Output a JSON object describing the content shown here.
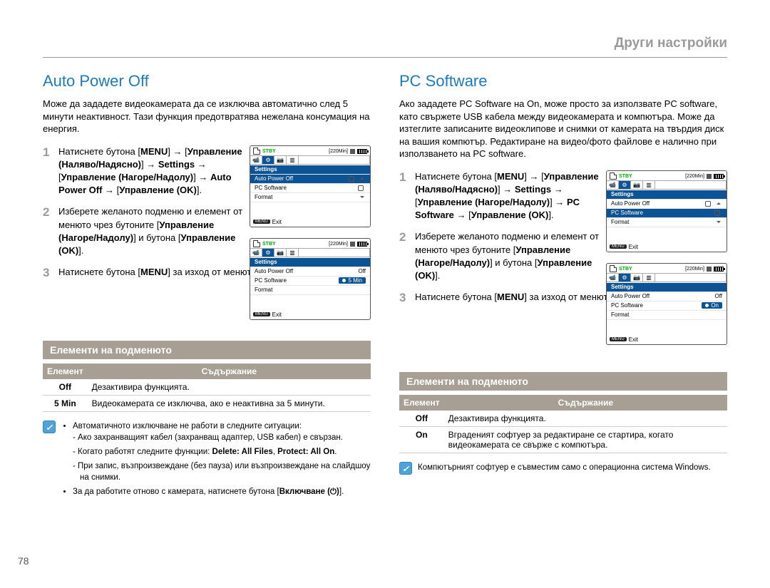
{
  "page_header": "Други настройки",
  "page_number": "78",
  "left": {
    "title": "Auto Power Off",
    "intro": "Може да зададете видеокамерата да се изключва автоматично след 5 минути неактивност. Тази функция предотвратява нежелана консумация на енергия.",
    "steps": [
      "Натиснете бутона [MENU] → [Управление (Наляво/Надясно)] → Settings → [Управление (Нагоре/Надолу)] → Auto Power Off → [Управление (OK)].",
      "Изберете желаното подменю и елемент от менюто чрез бутоните [Управление (Нагоре/Надолу)] и бутона [Управление (OK)].",
      "Натиснете бутона [MENU] за изход от менюто."
    ],
    "submenu_header": "Елементи на подменюто",
    "submenu_cols": {
      "c1": "Елемент",
      "c2": "Съдържание"
    },
    "submenu_rows": [
      {
        "name": "Off",
        "desc": "Дезактивира функцията."
      },
      {
        "name": "5 Min",
        "desc": "Видеокамерата се изключва, ако е неактивна за 5 минути."
      }
    ],
    "note_bullets": [
      "Автоматичното изключване не работи в следните ситуации:",
      "За да работите отново с камерата, натиснете бутона [Включване (⏻)]."
    ],
    "note_sub": [
      "Ако захранващият кабел (захранващ адаптер, USB кабел) е свързан.",
      "Когато работят следните функции: Delete: All Files, Protect: All On.",
      "При запис, възпроизвеждане (без пауза) или възпроизвеждане на слайдшоу на снимки."
    ],
    "screen1": {
      "stby": "STBY",
      "time": "[220Min]",
      "head": "Settings",
      "rows": [
        {
          "t": "Auto Power Off",
          "sel": true
        },
        {
          "t": "PC Software"
        },
        {
          "t": "Format"
        }
      ],
      "exit": "Exit",
      "menu": "MENU"
    },
    "screen2": {
      "stby": "STBY",
      "time": "[220Min]",
      "head": "Settings",
      "rows": [
        {
          "t": "Auto Power Off",
          "r": "Off"
        },
        {
          "t": "PC Software",
          "r": "5 Min",
          "pill": true
        },
        {
          "t": "Format"
        }
      ],
      "exit": "Exit",
      "menu": "MENU"
    }
  },
  "right": {
    "title": "PC Software",
    "intro": "Ако зададете PC Software на On, може просто за използвате PC software, като свържете USB кабела между видеокамерата и компютъра. Може да изтеглите записаните видеоклипове и снимки от камерата на твърдия диск на вашия компютър. Редактиране на видео/фото файлове е налично при използването на PC software.",
    "steps": [
      "Натиснете бутона [MENU] → [Управление (Наляво/Надясно)] → Settings → [Управление (Нагоре/Надолу)] → PC Software → [Управление (OK)].",
      "Изберете желаното подменю и елемент от менюто чрез бутоните [Управление (Нагоре/Надолу)] и бутона [Управление (OK)].",
      "Натиснете бутона [MENU] за изход от менюто."
    ],
    "submenu_header": "Елементи на подменюто",
    "submenu_cols": {
      "c1": "Елемент",
      "c2": "Съдържание"
    },
    "submenu_rows": [
      {
        "name": "Off",
        "desc": "Дезактивира функцията."
      },
      {
        "name": "On",
        "desc": "Вграденият софтуер за редактиране се стартира, когато видеокамерата се свърже с компютъра."
      }
    ],
    "note": "Компютърният софтуер е съвместим само с операционна система Windows.",
    "screen1": {
      "stby": "STBY",
      "time": "[220Min]",
      "head": "Settings",
      "rows": [
        {
          "t": "Auto Power Off"
        },
        {
          "t": "PC Software",
          "sel": true
        },
        {
          "t": "Format"
        }
      ],
      "exit": "Exit",
      "menu": "MENU"
    },
    "screen2": {
      "stby": "STBY",
      "time": "[220Min]",
      "head": "Settings",
      "rows": [
        {
          "t": "Auto Power Off",
          "r": "Off"
        },
        {
          "t": "PC Software",
          "r": "On",
          "pill": true,
          "sel": true
        },
        {
          "t": "Format"
        }
      ],
      "exit": "Exit",
      "menu": "MENU"
    }
  }
}
